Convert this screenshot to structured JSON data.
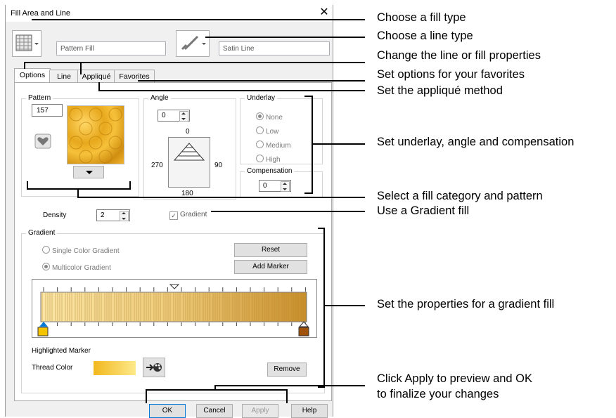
{
  "dialog": {
    "title": "Fill Area and Line",
    "close_glyph": "✕",
    "fill_type_value": "Pattern Fill",
    "line_type_value": "Satin Line",
    "tabs": [
      "Options",
      "Line",
      "Appliqué",
      "Favorites"
    ],
    "pattern": {
      "label": "Pattern",
      "number": "157"
    },
    "angle": {
      "label": "Angle",
      "value": "0",
      "dial_top": "0",
      "dial_left": "270",
      "dial_right": "90",
      "dial_bottom": "180"
    },
    "underlay": {
      "label": "Underlay",
      "options": [
        "None",
        "Low",
        "Medium",
        "High"
      ],
      "selected": "None"
    },
    "compensation": {
      "label": "Compensation",
      "value": "0"
    },
    "density": {
      "label": "Density",
      "value": "2"
    },
    "gradient_check": {
      "label": "Gradient",
      "checked": true
    },
    "gradient": {
      "label": "Gradient",
      "single_label": "Single Color Gradient",
      "multi_label": "Multicolor Gradient",
      "selected": "Multicolor Gradient",
      "reset_label": "Reset",
      "add_marker_label": "Add Marker",
      "highlighted_marker_label": "Highlighted Marker",
      "thread_color_label": "Thread Color",
      "remove_label": "Remove"
    },
    "buttons": {
      "ok": "OK",
      "cancel": "Cancel",
      "apply": "Apply",
      "help": "Help"
    }
  },
  "callouts": [
    "Choose a fill type",
    "Choose a line type",
    "Change the line or fill properties",
    "Set options for your favorites",
    "Set the appliqué method",
    "Set underlay, angle and compensation",
    "Select a fill category and pattern",
    "Use a Gradient fill",
    "Set the properties for a gradient fill",
    "Click Apply to preview and OK",
    "to finalize your changes"
  ],
  "colors": {
    "dialog_bg": "#f0f0f0",
    "gradient_light": "#fbe9b0",
    "gradient_dark": "#c98f2a",
    "pattern_gold": "#e7a81c",
    "marker_left": "#f5c400",
    "marker_right": "#a0520a",
    "accent_blue": "#0078d7"
  }
}
